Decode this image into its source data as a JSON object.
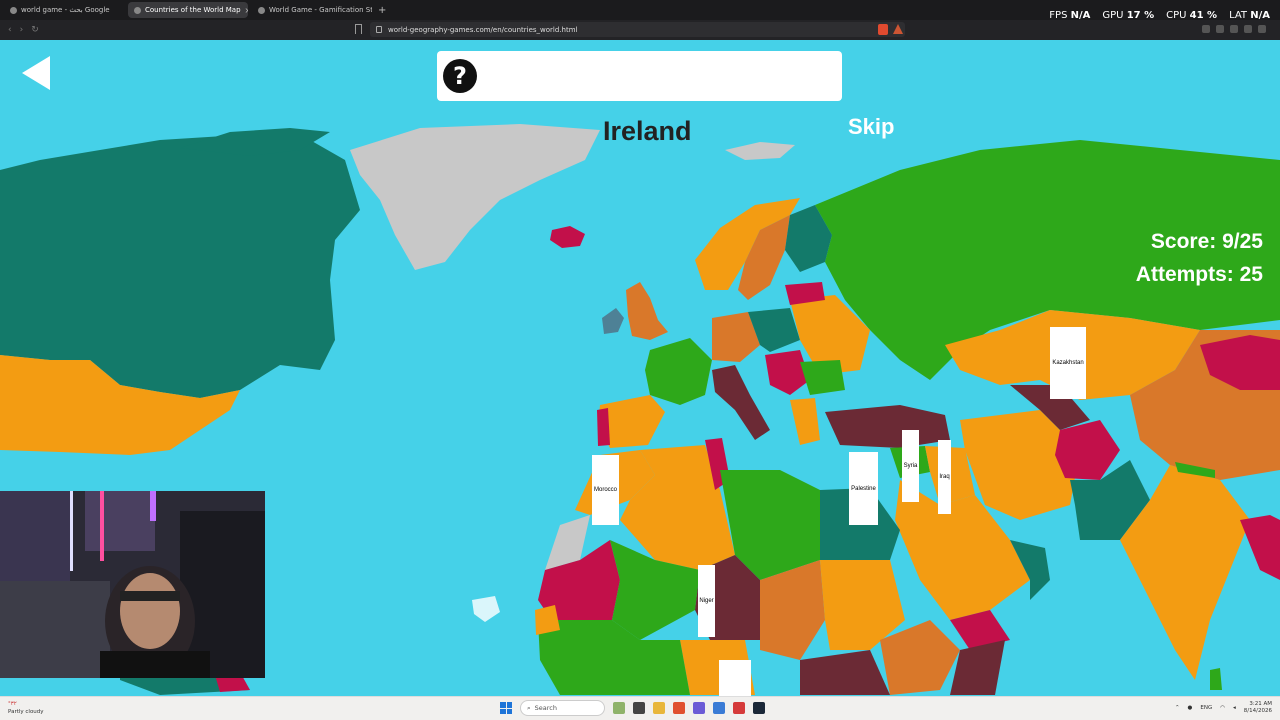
{
  "browser": {
    "tabs": [
      {
        "label": "world game - بحث Google",
        "active": false
      },
      {
        "label": "Countries of the World Map",
        "active": true
      },
      {
        "label": "World Game - Gamification Studio",
        "active": false
      }
    ],
    "url": "world-geography-games.com/en/countries_world.html",
    "hud": {
      "fps_label": "FPS",
      "fps_value": "N/A",
      "gpu_label": "GPU",
      "gpu_value": "17 %",
      "cpu_label": "CPU",
      "cpu_value": "41 %",
      "lat_label": "LAT",
      "lat_value": "N/A"
    }
  },
  "game": {
    "hint_icon": "?",
    "target_country": "Ireland",
    "skip_label": "Skip",
    "score_text": "Score: 9/25",
    "attempts_text": "Attempts: 25",
    "map_labels": {
      "kazakhstan": "Kazakhstan",
      "morocco": "Morocco",
      "palestine": "Palestine",
      "syria": "Syria",
      "iraq": "Iraq",
      "niger": "Niger"
    },
    "colors": {
      "ocean": "#45d1e8",
      "green": "#2ea81a",
      "teal": "#137a6a",
      "orange": "#f39c12",
      "brown": "#d9782a",
      "crimson": "#c2104a",
      "maroon": "#6b2a35",
      "grey": "#c8c8c8"
    }
  },
  "taskbar": {
    "weather_temp": "°٣٢",
    "weather_desc": "Partly cloudy",
    "search_placeholder": "Search",
    "lang": "ENG",
    "time": "3:21 AM",
    "date": "8/14/2026"
  }
}
